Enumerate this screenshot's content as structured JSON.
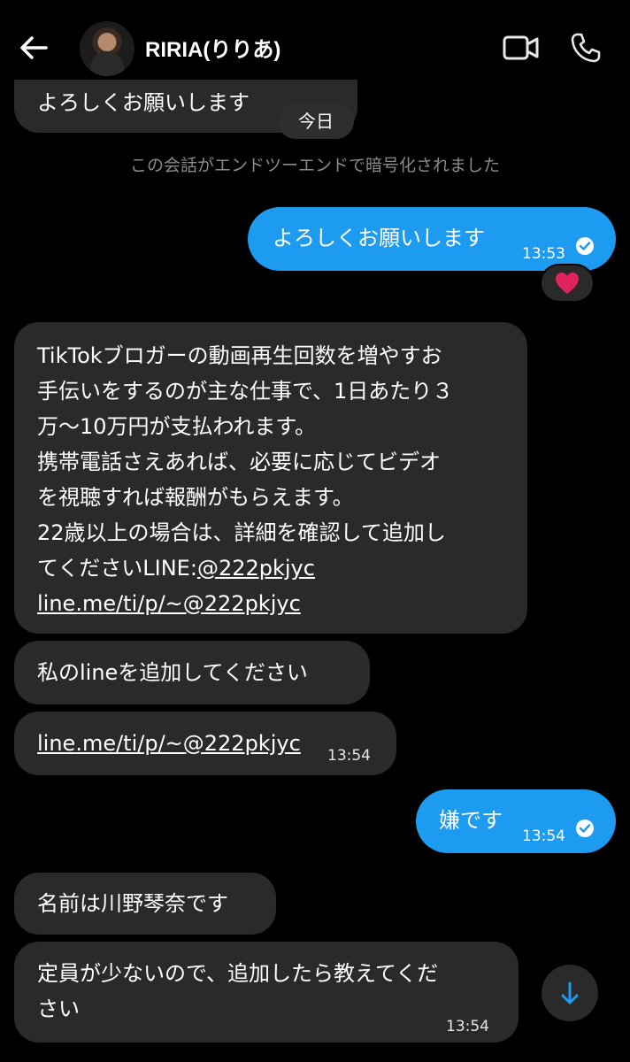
{
  "header": {
    "contact_name": "RIRIA(りりあ)",
    "icons": [
      "back-arrow-icon",
      "avatar",
      "video-call-icon",
      "phone-icon"
    ]
  },
  "conversation": {
    "prev_message": "よろしくお願いします",
    "date_divider": "今日",
    "encryption_notice": "この会話がエンドツーエンドで暗号化されました",
    "messages": [
      {
        "direction": "outgoing",
        "text": "よろしくお願いします",
        "time": "13:53",
        "status": "read-check-icon",
        "reaction": "❤️"
      },
      {
        "direction": "incoming",
        "lines": [
          "TikTokブロガーの動画再生回数を増やすお",
          "手伝いをするのが主な仕事で、1日あたり３",
          "万〜10万円が支払われます。",
          "携帯電話さえあれば、必要に応じてビデオ",
          "を視聴すれば報酬がもらえます。",
          "22歳以上の場合は、詳細を確認して追加し",
          "てくださいLINE:",
          "@222pkjyc",
          "line.me/ti/p/~@222pkjyc"
        ]
      },
      {
        "direction": "incoming",
        "text": "私のlineを追加してください"
      },
      {
        "direction": "incoming",
        "text": "line.me/ti/p/~@222pkjyc",
        "time": "13:54"
      },
      {
        "direction": "outgoing",
        "text": "嫌です",
        "time": "13:54",
        "status": "read-check-icon"
      },
      {
        "direction": "incoming",
        "text": "名前は川野琴奈です"
      },
      {
        "direction": "incoming",
        "lines": [
          "定員が少ないので、追加したら教えてくだ",
          "さい"
        ],
        "time": "13:54"
      }
    ]
  },
  "colors": {
    "background": "#000000",
    "incoming_bubble": "#2a2a2a",
    "outgoing_bubble": "#1d9bf0",
    "muted_text": "#8a8a8a"
  }
}
